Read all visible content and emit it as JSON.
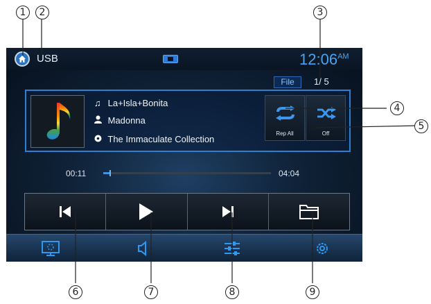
{
  "callouts": [
    "1",
    "2",
    "3",
    "4",
    "5",
    "6",
    "7",
    "8",
    "9"
  ],
  "status_bar": {
    "source": "USB",
    "clock_time": "12:06",
    "clock_ampm": "AM",
    "icons": [
      "home-icon",
      "battery-icon"
    ]
  },
  "browse": {
    "file_label": "File",
    "track_count": "1/ 5"
  },
  "now_playing": {
    "title": "La+Isla+Bonita",
    "artist": "Madonna",
    "album": "The Immaculate Collection",
    "icons": [
      "music-note-icon",
      "person-icon",
      "disc-icon",
      "album-art-music-note-icon"
    ]
  },
  "modes": {
    "repeat_label": "Rep All",
    "shuffle_label": "Off",
    "icons": [
      "repeat-icon",
      "shuffle-icon"
    ]
  },
  "progress": {
    "elapsed": "00:11",
    "total": "04:04",
    "fraction": 0.045
  },
  "transport": {
    "icons": [
      "previous-icon",
      "play-icon",
      "next-icon",
      "folder-icon"
    ]
  },
  "bottom_nav": {
    "icons": [
      "display-icon",
      "volume-icon",
      "equalizer-icon",
      "settings-icon"
    ]
  },
  "colors": {
    "accent": "#2d7fd0",
    "clock": "#4aa3f0",
    "background": "#0f2238"
  }
}
